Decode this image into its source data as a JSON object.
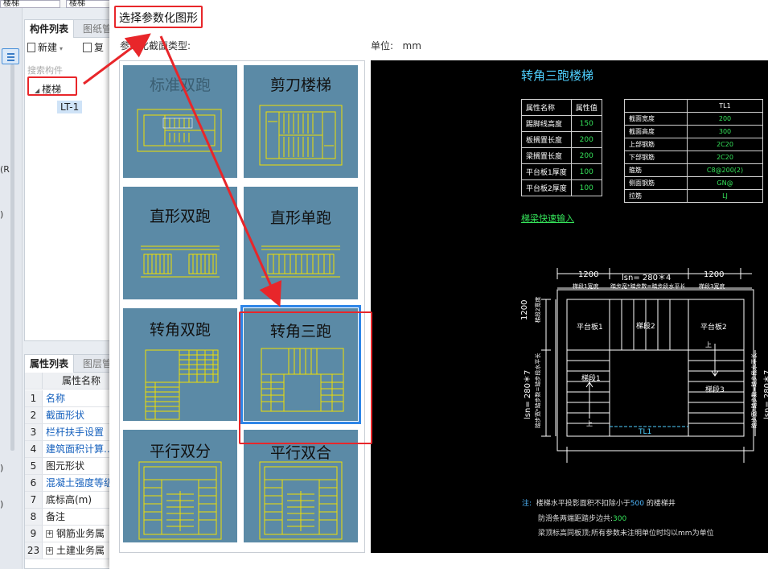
{
  "bg": {
    "combo1": "楼梯",
    "combo2": "楼梯",
    "tabs": {
      "component_list": "构件列表",
      "drawing": "图纸管"
    },
    "toolbar": {
      "new": "新建",
      "copy": "复"
    },
    "search_placeholder": "搜索构件",
    "tree": {
      "root": "楼梯",
      "child": "LT-1"
    },
    "left_cut": [
      "(R",
      ")",
      ")",
      ")"
    ],
    "prop_tabs": {
      "props": "属性列表",
      "layers": "图层管"
    },
    "prop_header": "属性名称",
    "props": [
      {
        "num": "1",
        "name": "名称",
        "blue": true
      },
      {
        "num": "2",
        "name": "截面形状",
        "blue": true
      },
      {
        "num": "3",
        "name": "栏杆扶手设置",
        "blue": true
      },
      {
        "num": "4",
        "name": "建筑面积计算...",
        "blue": true
      },
      {
        "num": "5",
        "name": "图元形状",
        "blue": false
      },
      {
        "num": "6",
        "name": "混凝土强度等级",
        "blue": true
      },
      {
        "num": "7",
        "name": "底标高(m)",
        "blue": false
      },
      {
        "num": "8",
        "name": "备注",
        "blue": false
      },
      {
        "num": "9",
        "name": "钢筋业务属",
        "blue": false,
        "expand": true
      },
      {
        "num": "23",
        "name": "土建业务属",
        "blue": false,
        "expand": true
      }
    ]
  },
  "dialog": {
    "title": "选择参数化图形",
    "section_label": "参数化截面类型:",
    "unit_label": "单位:",
    "unit_value": "mm",
    "shapes": [
      {
        "label": "标准双跑",
        "selected": false
      },
      {
        "label": "剪刀楼梯",
        "selected": false
      },
      {
        "label": "直形双跑",
        "selected": false
      },
      {
        "label": "直形单跑",
        "selected": false
      },
      {
        "label": "转角双跑",
        "selected": false
      },
      {
        "label": "转角三跑",
        "selected": true
      },
      {
        "label": "平行双分",
        "selected": false
      },
      {
        "label": "平行双合",
        "selected": false
      }
    ]
  },
  "preview": {
    "title": "转角三跑楼梯",
    "table1": {
      "header": [
        "属性名称",
        "属性值"
      ],
      "rows": [
        [
          "踢脚线高度",
          "150"
        ],
        [
          "板搁置长度",
          "200"
        ],
        [
          "梁搁置长度",
          "200"
        ],
        [
          "平台板1厚度",
          "100"
        ],
        [
          "平台板2厚度",
          "100"
        ]
      ]
    },
    "table2": {
      "header": [
        "",
        "TL1"
      ],
      "rows": [
        [
          "截面宽度",
          "200"
        ],
        [
          "截面高度",
          "300"
        ],
        [
          "上部钢筋",
          "2C20"
        ],
        [
          "下部钢筋",
          "2C20"
        ],
        [
          "箍筋",
          "C8@200(2)"
        ],
        [
          "侧面钢筋",
          "GN@"
        ],
        [
          "拉筋",
          "LJ"
        ]
      ]
    },
    "quick_input": "梯梁快速输入",
    "dims": {
      "top_left": "1200",
      "top_mid": "lsn= 280＊4",
      "top_right": "1200",
      "row_label_left": "梯段1宽度",
      "row_label_mid": "踏步宽*踏步数=踏步段水平长",
      "row_label_right": "梯段3宽度",
      "left_top": "1200",
      "left_top_label": "梯段2宽度",
      "left_mid": "lsn= 280＊7",
      "left_mid_label": "踏步宽*踏步数=踏步段水平长",
      "right_mid": "lsn= 280＊7",
      "right_mid_label": "踏步宽*踏步数=踏步段水平长"
    },
    "labels": {
      "platform1": "平台板1",
      "flight2": "梯段2",
      "platform2": "平台板2",
      "flight1": "梯段1",
      "flight3": "梯段3",
      "tl1": "TL1",
      "up1": "上",
      "up2": "上"
    },
    "notes": {
      "prefix": "注:",
      "line1_a": "楼梯水平投影面积不扣除小于",
      "line1_b": "500",
      "line1_c": "的楼梯井",
      "line2_a": "防滑条两端距踏步边共:",
      "line2_b": "300",
      "line3": "梁顶标高同板顶;所有参数未注明单位时均以mm为单位"
    }
  },
  "colors": {
    "thumb_bg": "#5b8aa6",
    "highlight": "#e8262a",
    "accent_green": "#35e35a",
    "accent_blue": "#4fd0ff"
  }
}
